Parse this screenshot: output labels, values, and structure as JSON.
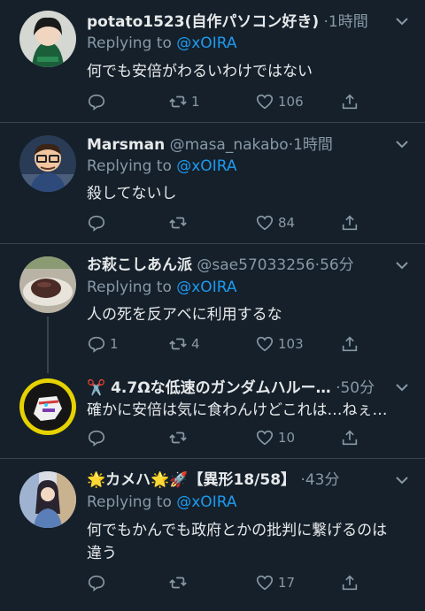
{
  "tweets": [
    {
      "name": "potato1523(自作パソコン好き)",
      "handle": "",
      "time": "1時間",
      "replying_prefix": "Replying to ",
      "replying_to": "@xOIRA",
      "text": "何でも安倍がわるいわけではない",
      "counts": {
        "reply": "",
        "retweet": "1",
        "like": "106"
      }
    },
    {
      "name": "Marsman",
      "handle": "@masa_nakabo",
      "time": "1時間",
      "replying_prefix": "Replying to ",
      "replying_to": "@xOIRA",
      "text": "殺してないし",
      "counts": {
        "reply": "",
        "retweet": "",
        "like": "84"
      }
    },
    {
      "name": "お萩こしあん派",
      "handle": "@sae57033256",
      "time": "56分",
      "replying_prefix": "Replying to ",
      "replying_to": "@xOIRA",
      "text": "人の死を反アベに利用するな",
      "counts": {
        "reply": "1",
        "retweet": "4",
        "like": "103"
      }
    },
    {
      "name": "✂️ 4.7Ωな低速のガンダムハルー…",
      "handle": "",
      "time": "50分",
      "text": "確かに安倍は気に食わんけどこれは…ねぇ…",
      "counts": {
        "reply": "",
        "retweet": "",
        "like": "10"
      }
    },
    {
      "name": "🌟カメハ🌟🚀【異形18/58】",
      "handle": "",
      "time": "43分",
      "replying_prefix": "Replying to ",
      "replying_to": "@xOIRA",
      "text": "何でもかんでも政府とかの批判に繋げるのは\n違う",
      "counts": {
        "reply": "",
        "retweet": "",
        "like": "17"
      }
    }
  ],
  "dot": "·",
  "icons": [
    "reply-icon",
    "retweet-icon",
    "like-icon",
    "share-icon",
    "chevron-down-icon"
  ],
  "colors": {
    "background": "#15202b",
    "link": "#1d9bf0",
    "muted": "#8899a6",
    "divider": "#38444d"
  }
}
